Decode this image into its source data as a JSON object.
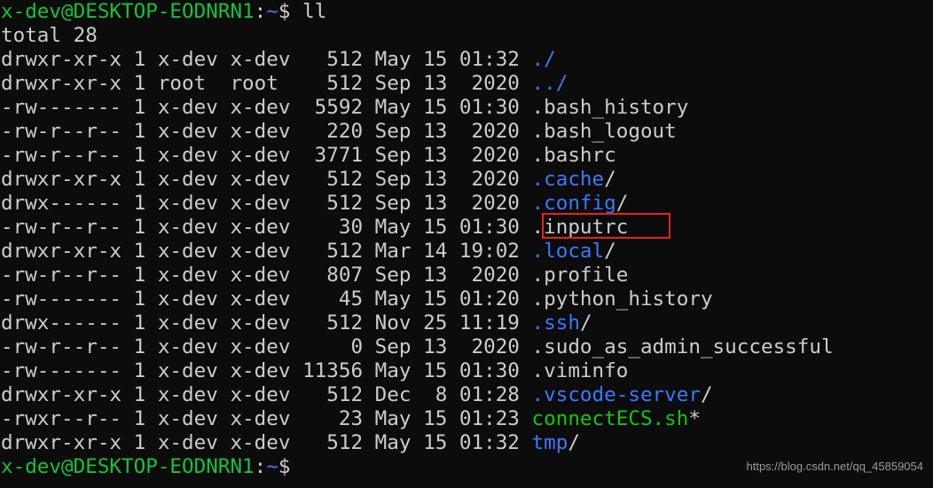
{
  "prompt1": {
    "user": "x-dev@DESKTOP-EODNRN1",
    "sep": ":",
    "path": "~",
    "sign": "$",
    "command": " ll"
  },
  "total_line": "total 28",
  "entries": [
    {
      "meta": "drwxr-xr-x 1 x-dev x-dev   512 May 15 01:32 ",
      "name": "./",
      "kind": "dir",
      "suffix": ""
    },
    {
      "meta": "drwxr-xr-x 1 root  root    512 Sep 13  2020 ",
      "name": "../",
      "kind": "dir",
      "suffix": ""
    },
    {
      "meta": "-rw------- 1 x-dev x-dev  5592 May 15 01:30 ",
      "name": ".bash_history",
      "kind": "file",
      "suffix": ""
    },
    {
      "meta": "-rw-r--r-- 1 x-dev x-dev   220 Sep 13  2020 ",
      "name": ".bash_logout",
      "kind": "file",
      "suffix": ""
    },
    {
      "meta": "-rw-r--r-- 1 x-dev x-dev  3771 Sep 13  2020 ",
      "name": ".bashrc",
      "kind": "file",
      "suffix": ""
    },
    {
      "meta": "drwxr-xr-x 1 x-dev x-dev   512 Sep 13  2020 ",
      "name": ".cache",
      "kind": "dir",
      "suffix": "/"
    },
    {
      "meta": "drwx------ 1 x-dev x-dev   512 Sep 13  2020 ",
      "name": ".config",
      "kind": "dir",
      "suffix": "/"
    },
    {
      "meta": "-rw-r--r-- 1 x-dev x-dev    30 May 15 01:30 ",
      "name": ".inputrc",
      "kind": "file",
      "suffix": ""
    },
    {
      "meta": "drwxr-xr-x 1 x-dev x-dev   512 Mar 14 19:02 ",
      "name": ".local",
      "kind": "dir",
      "suffix": "/"
    },
    {
      "meta": "-rw-r--r-- 1 x-dev x-dev   807 Sep 13  2020 ",
      "name": ".profile",
      "kind": "file",
      "suffix": ""
    },
    {
      "meta": "-rw------- 1 x-dev x-dev    45 May 15 01:20 ",
      "name": ".python_history",
      "kind": "file",
      "suffix": ""
    },
    {
      "meta": "drwx------ 1 x-dev x-dev   512 Nov 25 11:19 ",
      "name": ".ssh",
      "kind": "dir",
      "suffix": "/"
    },
    {
      "meta": "-rw-r--r-- 1 x-dev x-dev     0 Sep 13  2020 ",
      "name": ".sudo_as_admin_successful",
      "kind": "file",
      "suffix": ""
    },
    {
      "meta": "-rw------- 1 x-dev x-dev 11356 May 15 01:30 ",
      "name": ".viminfo",
      "kind": "file",
      "suffix": ""
    },
    {
      "meta": "drwxr-xr-x 1 x-dev x-dev   512 Dec  8 01:28 ",
      "name": ".vscode-server",
      "kind": "dir",
      "suffix": "/"
    },
    {
      "meta": "-rwxr--r-- 1 x-dev x-dev    23 May 15 01:23 ",
      "name": "connectECS.sh",
      "kind": "exec",
      "suffix": "*"
    },
    {
      "meta": "drwxr-xr-x 1 x-dev x-dev   512 May 15 01:32 ",
      "name": "tmp",
      "kind": "dir",
      "suffix": "/"
    }
  ],
  "prompt2": {
    "user": "x-dev@DESKTOP-EODNRN1",
    "sep": ":",
    "path": "~",
    "sign": "$"
  },
  "watermark": "https://blog.csdn.net/qq_45859054",
  "colors": {
    "background": "#0c0c0c",
    "text": "#cccccc",
    "prompt_user": "#13c33e",
    "directory": "#3b78ff",
    "executable": "#16c60c",
    "highlight": "#e52222"
  }
}
